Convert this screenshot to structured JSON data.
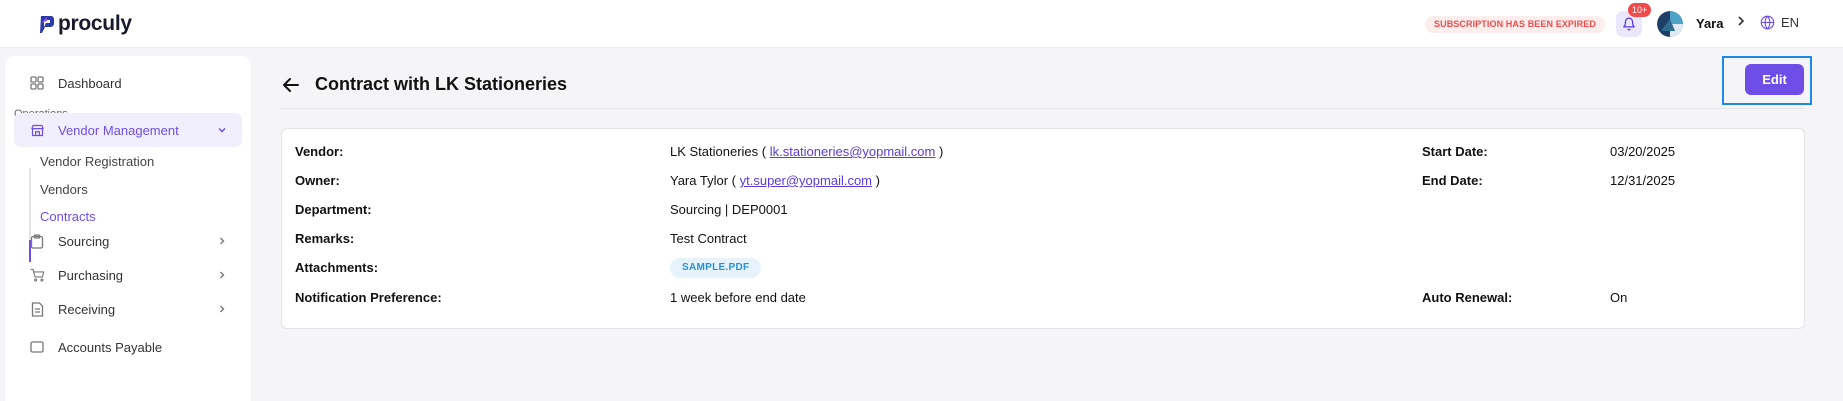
{
  "header": {
    "logo_text": "proculy",
    "subscription_banner": "SUBSCRIPTION HAS BEEN EXPIRED",
    "notification_count": "10+",
    "user_name": "Yara",
    "language": "EN",
    "accent_color": "#6f4ee8"
  },
  "sidebar": {
    "dashboard": "Dashboard",
    "section_operations": "Operations",
    "vendor_management": "Vendor Management",
    "sub_items": [
      "Vendor Registration",
      "Vendors",
      "Contracts"
    ],
    "sourcing": "Sourcing",
    "purchasing": "Purchasing",
    "receiving": "Receiving",
    "accounts_payable": "Accounts Payable"
  },
  "main": {
    "title": "Contract with LK Stationeries",
    "edit_label": "Edit"
  },
  "contract": {
    "vendor_label": "Vendor:",
    "vendor_name": "LK Stationeries ( ",
    "vendor_email": "lk.stationeries@yopmail.com",
    "vendor_close": " )",
    "owner_label": "Owner:",
    "owner_name": "Yara Tylor ( ",
    "owner_email": "yt.super@yopmail.com",
    "owner_close": " )",
    "department_label": "Department:",
    "department_value": "Sourcing | DEP0001",
    "remarks_label": "Remarks:",
    "remarks_value": "Test Contract",
    "attachments_label": "Attachments:",
    "attachment_file": "SAMPLE.PDF",
    "notification_label": "Notification Preference:",
    "notification_value": "1 week before end date",
    "start_date_label": "Start Date:",
    "start_date_value": "03/20/2025",
    "end_date_label": "End Date:",
    "end_date_value": "12/31/2025",
    "auto_renewal_label": "Auto Renewal:",
    "auto_renewal_value": "On"
  }
}
